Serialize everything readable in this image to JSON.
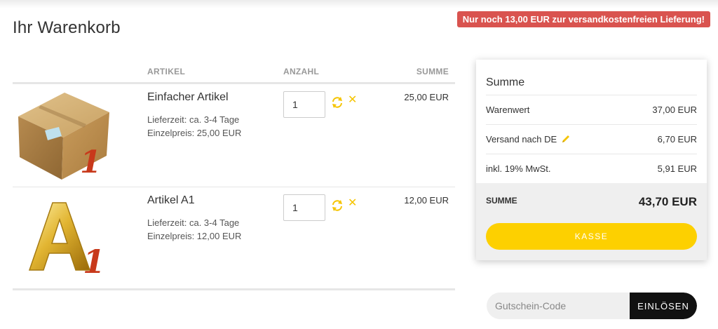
{
  "page": {
    "title": "Ihr Warenkorb",
    "free_shipping_notice": "Nur noch 13,00 EUR zur versandkostenfreien Lieferung!"
  },
  "cart": {
    "headers": {
      "article": "ARTIKEL",
      "quantity": "ANZAHL",
      "sum": "SUMME"
    },
    "items": [
      {
        "name": "Einfacher Artikel",
        "delivery": "Lieferzeit: ca. 3-4 Tage",
        "unit_price": "Einzelpreis: 25,00 EUR",
        "quantity": "1",
        "total": "25,00 EUR",
        "image_icon": "cardboard-box-1"
      },
      {
        "name": "Artikel A1",
        "delivery": "Lieferzeit: ca. 3-4 Tage",
        "unit_price": "Einzelpreis: 12,00 EUR",
        "quantity": "1",
        "total": "12,00 EUR",
        "image_icon": "gold-letter-a1"
      }
    ]
  },
  "summary": {
    "title": "Summe",
    "lines": [
      {
        "label": "Warenwert",
        "value": "37,00 EUR"
      },
      {
        "label": "Versand nach DE",
        "value": "6,70 EUR"
      },
      {
        "label": "inkl. 19% MwSt.",
        "value": "5,91 EUR"
      }
    ],
    "total_label": "SUMME",
    "total_value": "43,70 EUR",
    "checkout_label": "KASSE"
  },
  "coupon": {
    "placeholder": "Gutschein-Code",
    "value": "",
    "button_label": "EINLÖSEN"
  },
  "colors": {
    "accent": "#fdd000",
    "notice": "#d9534f",
    "digit_red": "#c8391b",
    "dark_button": "#111111"
  }
}
